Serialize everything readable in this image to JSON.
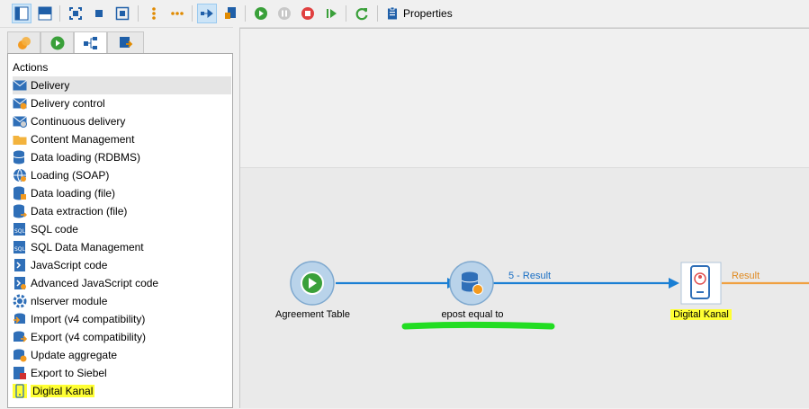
{
  "toolbar": {
    "properties_label": "Properties",
    "icons": [
      "layout-left-icon",
      "layout-top-icon",
      "fit-icon",
      "normalize-icon",
      "zoom-icon",
      "vertical-dots-icon",
      "horizontal-dots-icon",
      "auto-link-icon",
      "doc-icon",
      "start-icon",
      "pause-icon",
      "stop-icon",
      "step-icon",
      "refresh-icon",
      "properties-icon"
    ]
  },
  "tabs": [
    "activities-tab",
    "start-tab",
    "workflow-tab",
    "export-tab"
  ],
  "panel": {
    "title": "Actions",
    "items": [
      {
        "label": "Delivery",
        "icon": "delivery-icon"
      },
      {
        "label": "Delivery control",
        "icon": "delivery-control-icon"
      },
      {
        "label": "Continuous delivery",
        "icon": "continuous-delivery-icon"
      },
      {
        "label": "Content Management",
        "icon": "folder-icon"
      },
      {
        "label": "Data loading (RDBMS)",
        "icon": "database-icon"
      },
      {
        "label": "Loading (SOAP)",
        "icon": "globe-icon"
      },
      {
        "label": "Data loading (file)",
        "icon": "database-file-icon"
      },
      {
        "label": "Data extraction (file)",
        "icon": "file-extract-icon"
      },
      {
        "label": "SQL code",
        "icon": "sql-icon"
      },
      {
        "label": "SQL Data Management",
        "icon": "sql-data-icon"
      },
      {
        "label": "JavaScript code",
        "icon": "script-icon"
      },
      {
        "label": "Advanced JavaScript code",
        "icon": "advanced-script-icon"
      },
      {
        "label": "nlserver module",
        "icon": "gear-icon"
      },
      {
        "label": "Import (v4 compatibility)",
        "icon": "import-icon"
      },
      {
        "label": "Export (v4 compatibility)",
        "icon": "export-icon"
      },
      {
        "label": "Update aggregate",
        "icon": "aggregate-icon"
      },
      {
        "label": "Export to Siebel",
        "icon": "siebel-icon"
      },
      {
        "label": "Digital Kanal",
        "icon": "digital-icon"
      }
    ]
  },
  "canvas": {
    "nodes": [
      {
        "label": "Agreement Table",
        "icon": "play-icon"
      },
      {
        "label": "epost equal to",
        "icon": "database-query-icon"
      },
      {
        "label": "Digital Kanal",
        "icon": "phone-icon"
      }
    ],
    "connections": [
      "5 - Result",
      "Result"
    ]
  },
  "colors": {
    "accent": "#1a7fd4",
    "highlight": "#ffff33",
    "marker": "#22dd22",
    "outgoing": "#f0a040"
  }
}
